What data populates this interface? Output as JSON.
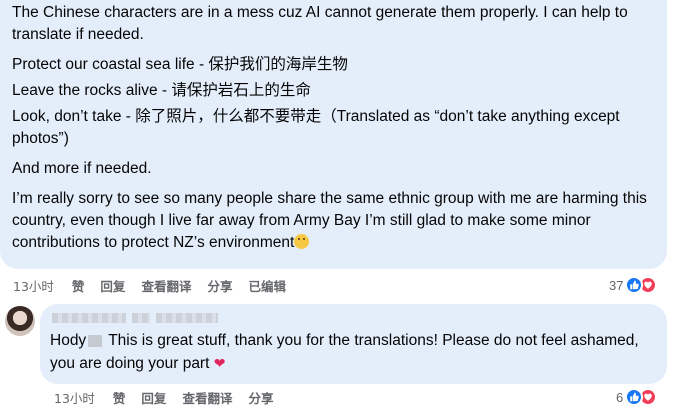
{
  "comment1": {
    "paragraphs": [
      "The Chinese characters are in a mess cuz AI cannot generate them properly. I can help to translate if needed.",
      "Protect our coastal sea life - 保护我们的海岸生物",
      "Leave the rocks alive - 请保护岩石上的生命",
      "Look, don’t take - 除了照片，什么都不要带走（Translated as “don’t take anything except photos”)",
      "And more if needed.",
      "I’m really sorry to see so many people share the same ethnic group with me are harming this country, even though I live far away from Army Bay I’m still glad to make some minor contributions to protect NZ’s environment"
    ],
    "emoji": "sad-face-emoji",
    "actions": {
      "time": "13小时",
      "like": "赞",
      "reply": "回复",
      "translate": "查看翻译",
      "share": "分享",
      "edited": "已编辑"
    },
    "reactions": {
      "count": "37",
      "icons": [
        "like-icon",
        "love-icon"
      ]
    }
  },
  "comment2": {
    "text_prefix": "Hody",
    "text_main": "This is great stuff, thank you for the translations! Please do not feel ashamed, you are doing your part",
    "heart": "❤",
    "actions": {
      "time": "13小时",
      "like": "赞",
      "reply": "回复",
      "translate": "查看翻译",
      "share": "分享"
    },
    "reactions": {
      "count": "6",
      "icons": [
        "like-icon",
        "love-icon"
      ]
    }
  }
}
